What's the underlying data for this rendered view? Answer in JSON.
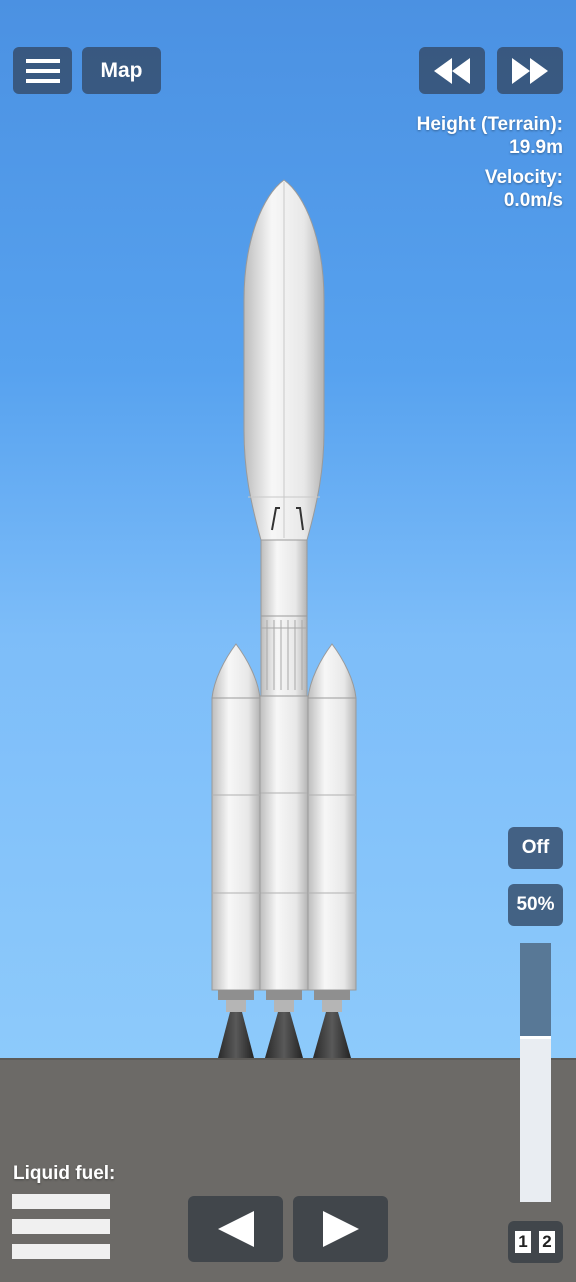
{
  "toolbar": {
    "menu_icon": "hamburger-menu-icon",
    "map_label": "Map",
    "rewind_icon": "rewind-icon",
    "fastforward_icon": "fast-forward-icon"
  },
  "telemetry": {
    "height_label": "Height (Terrain):",
    "height_value": "19.9m",
    "velocity_label": "Velocity:",
    "velocity_value": "0.0m/s"
  },
  "controls": {
    "off_label": "Off",
    "throttle_label": "50%",
    "throttle_bar_level": 0.64
  },
  "fuel": {
    "label": "Liquid fuel:"
  },
  "navigation": {
    "left_icon": "triangle-left-icon",
    "right_icon": "triangle-right-icon"
  },
  "stages": [
    "1",
    "2"
  ],
  "colors": {
    "sky_top": "#4b91e2",
    "sky_bottom": "#8dcafb",
    "ground": "#6c6a67",
    "button_bg": "#344c6a",
    "rocket_body": "#eeeeee"
  }
}
